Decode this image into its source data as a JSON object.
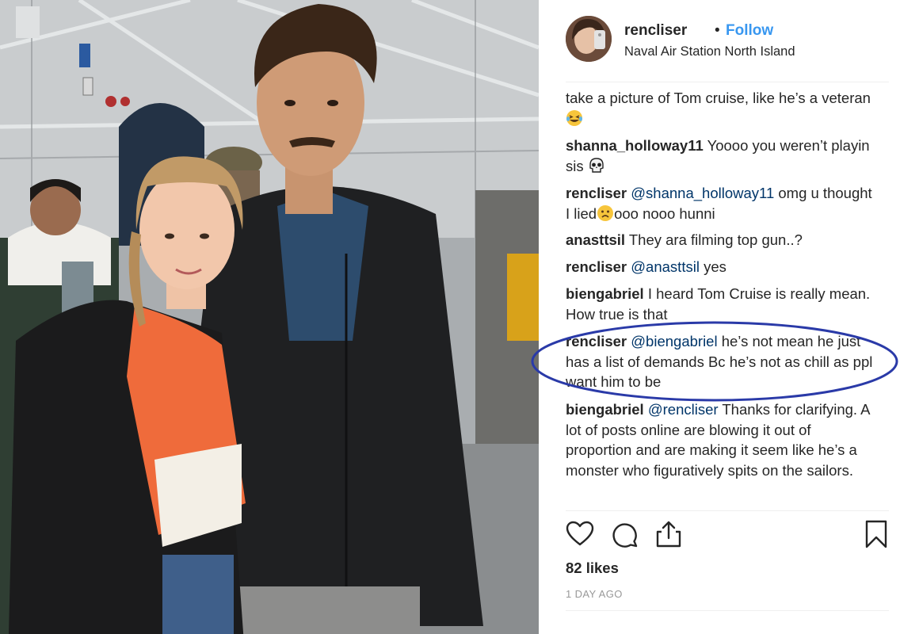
{
  "post": {
    "username": "rencliser",
    "separator": "•",
    "follow_label": "Follow",
    "location": "Naval Air Station North Island",
    "likes": "82 likes",
    "timestamp": "1 DAY AGO"
  },
  "comments": [
    {
      "user": "",
      "mention": "",
      "text": "take a picture of Tom cruise, like he’s a veteran",
      "emoji": "laughing-tears"
    },
    {
      "user": "shanna_holloway11",
      "mention": "",
      "text": "Yoooo you weren’t playin sis",
      "emoji": "skull"
    },
    {
      "user": "rencliser",
      "mention": "@shanna_holloway11",
      "text": "omg u thought I lied",
      "emoji": "sad-face",
      "text_after": "ooo nooo hunni"
    },
    {
      "user": "anasttsil",
      "mention": "",
      "text": "They ara filming top gun..?",
      "emoji": ""
    },
    {
      "user": "rencliser",
      "mention": "@anasttsil",
      "text": "yes",
      "emoji": ""
    },
    {
      "user": "biengabriel",
      "mention": "",
      "text": "I heard Tom Cruise is really mean. How true is that",
      "emoji": ""
    },
    {
      "user": "rencliser",
      "mention": "@biengabriel",
      "text": "he’s not mean he just has a list of demands Bc he’s not as chill as ppl want him to be",
      "emoji": ""
    },
    {
      "user": "biengabriel",
      "mention": "@rencliser",
      "text": "Thanks for clarifying. A lot of posts online are blowing it out of proportion and are making it seem like he’s a monster who figuratively spits on the sailors.",
      "emoji": ""
    }
  ],
  "icons": {
    "like": "heart-icon",
    "comment": "comment-bubble-icon",
    "share": "share-icon",
    "save": "bookmark-icon"
  },
  "colors": {
    "follow": "#3897f0",
    "mention": "#003569",
    "highlight": "#2a3aa8",
    "muted": "#999999"
  }
}
